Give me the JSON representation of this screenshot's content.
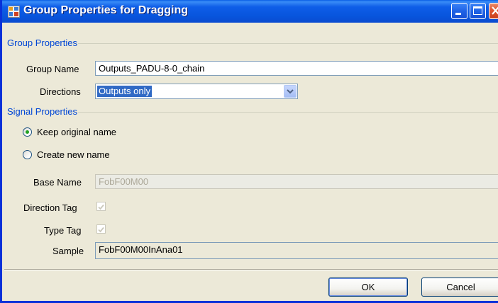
{
  "window": {
    "title": "Group Properties for Dragging"
  },
  "group_properties": {
    "legend": "Group Properties",
    "group_name_label": "Group Name",
    "group_name_value": "Outputs_PADU-8-0_chain",
    "directions_label": "Directions",
    "directions_value": "Outputs only"
  },
  "signal_properties": {
    "legend": "Signal Properties",
    "keep_original_label": "Keep original name",
    "keep_original_selected": true,
    "create_new_label": "Create new name",
    "create_new_selected": false,
    "base_name_label": "Base Name",
    "base_name_value": "FobF00M00",
    "direction_tag_label": "Direction Tag",
    "direction_tag_checked": true,
    "type_tag_label": "Type Tag",
    "type_tag_checked": true,
    "sample_label": "Sample",
    "sample_value": "FobF00M00InAna01"
  },
  "buttons": {
    "ok": "OK",
    "cancel": "Cancel"
  },
  "colors": {
    "titlebar": "#0855dd",
    "dialog_bg": "#ece9d8",
    "group_legend": "#0046d5",
    "selection": "#316ac5",
    "radio_dot": "#21a121"
  },
  "icons": {
    "app_icon": "window-app-icon",
    "minimize": "minimize-icon",
    "maximize": "maximize-icon",
    "close": "close-icon",
    "dropdown": "chevron-down-icon"
  }
}
